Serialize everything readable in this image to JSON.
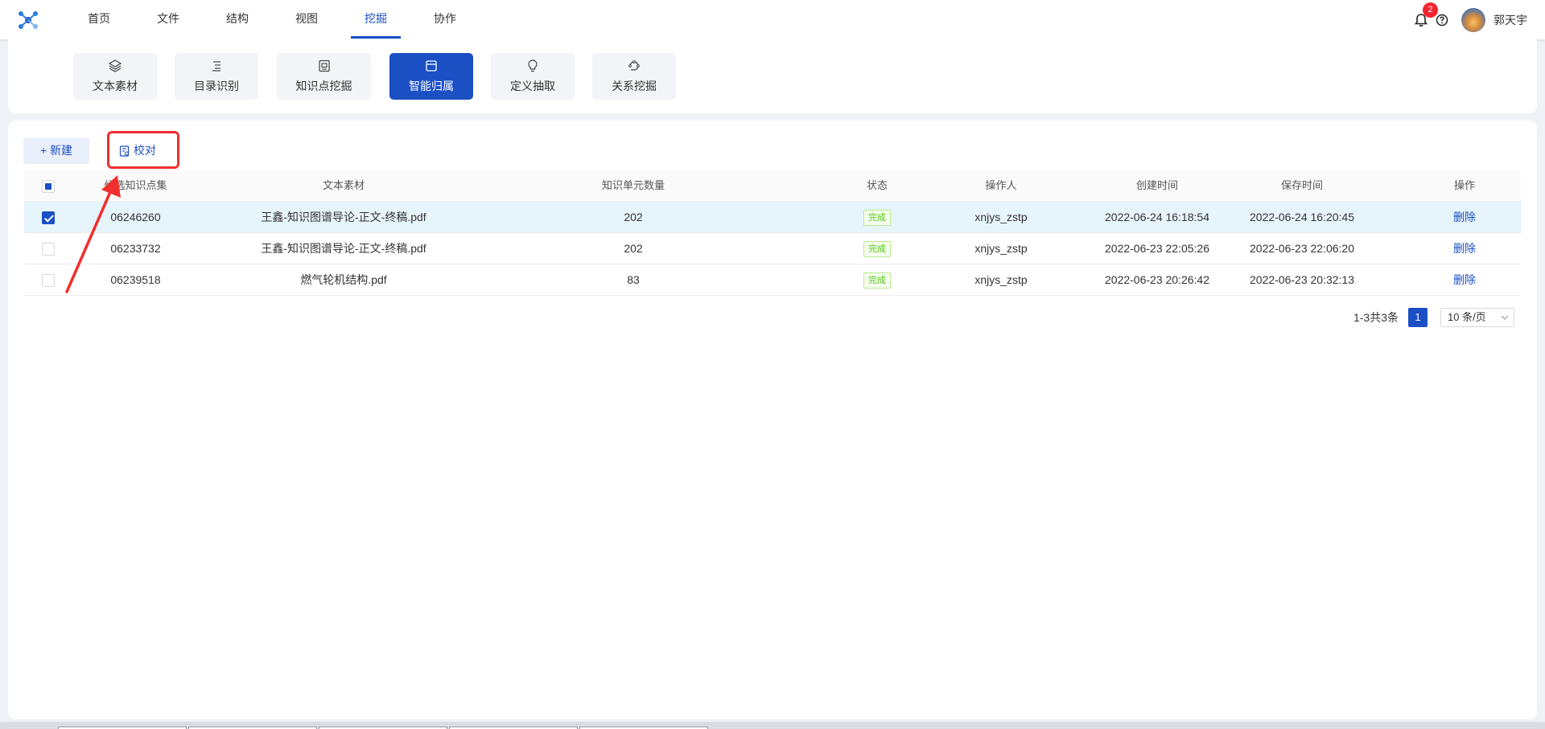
{
  "nav": {
    "items": [
      "首页",
      "文件",
      "结构",
      "视图",
      "挖掘",
      "协作"
    ],
    "active_index": 4
  },
  "header": {
    "notification_count": "2",
    "username": "郭天宇"
  },
  "tools": {
    "items": [
      {
        "label": "文本素材",
        "icon": "layers-icon"
      },
      {
        "label": "目录识别",
        "icon": "list-icon"
      },
      {
        "label": "知识点挖掘",
        "icon": "knowledge-icon"
      },
      {
        "label": "智能归属",
        "icon": "window-icon"
      },
      {
        "label": "定义抽取",
        "icon": "bulb-icon"
      },
      {
        "label": "关系挖掘",
        "icon": "relation-icon"
      }
    ],
    "active_index": 3
  },
  "actions": {
    "new_label": "+ 新建",
    "check_label": "校对"
  },
  "table": {
    "columns": [
      "候选知识点集",
      "文本素材",
      "知识单元数量",
      "状态",
      "操作人",
      "创建时间",
      "保存时间",
      "操作"
    ],
    "rows": [
      {
        "checked": true,
        "set": "06246260",
        "source": "王鑫-知识图谱导论-正文-终稿.pdf",
        "count": "202",
        "status": "完成",
        "operator": "xnjys_zstp",
        "created": "2022-06-24 16:18:54",
        "saved": "2022-06-24 16:20:45",
        "action": "删除"
      },
      {
        "checked": false,
        "set": "06233732",
        "source": "王鑫-知识图谱导论-正文-终稿.pdf",
        "count": "202",
        "status": "完成",
        "operator": "xnjys_zstp",
        "created": "2022-06-23 22:05:26",
        "saved": "2022-06-23 22:06:20",
        "action": "删除"
      },
      {
        "checked": false,
        "set": "06239518",
        "source": "燃气轮机结构.pdf",
        "count": "83",
        "status": "完成",
        "operator": "xnjys_zstp",
        "created": "2022-06-23 20:26:42",
        "saved": "2022-06-23 20:32:13",
        "action": "删除"
      }
    ]
  },
  "pagination": {
    "total_text": "1-3共3条",
    "current_page": "1",
    "page_size": "10 条/页"
  },
  "colors": {
    "primary": "#1b4fc4",
    "annotation": "#f0302e",
    "success": "#52c41a"
  }
}
